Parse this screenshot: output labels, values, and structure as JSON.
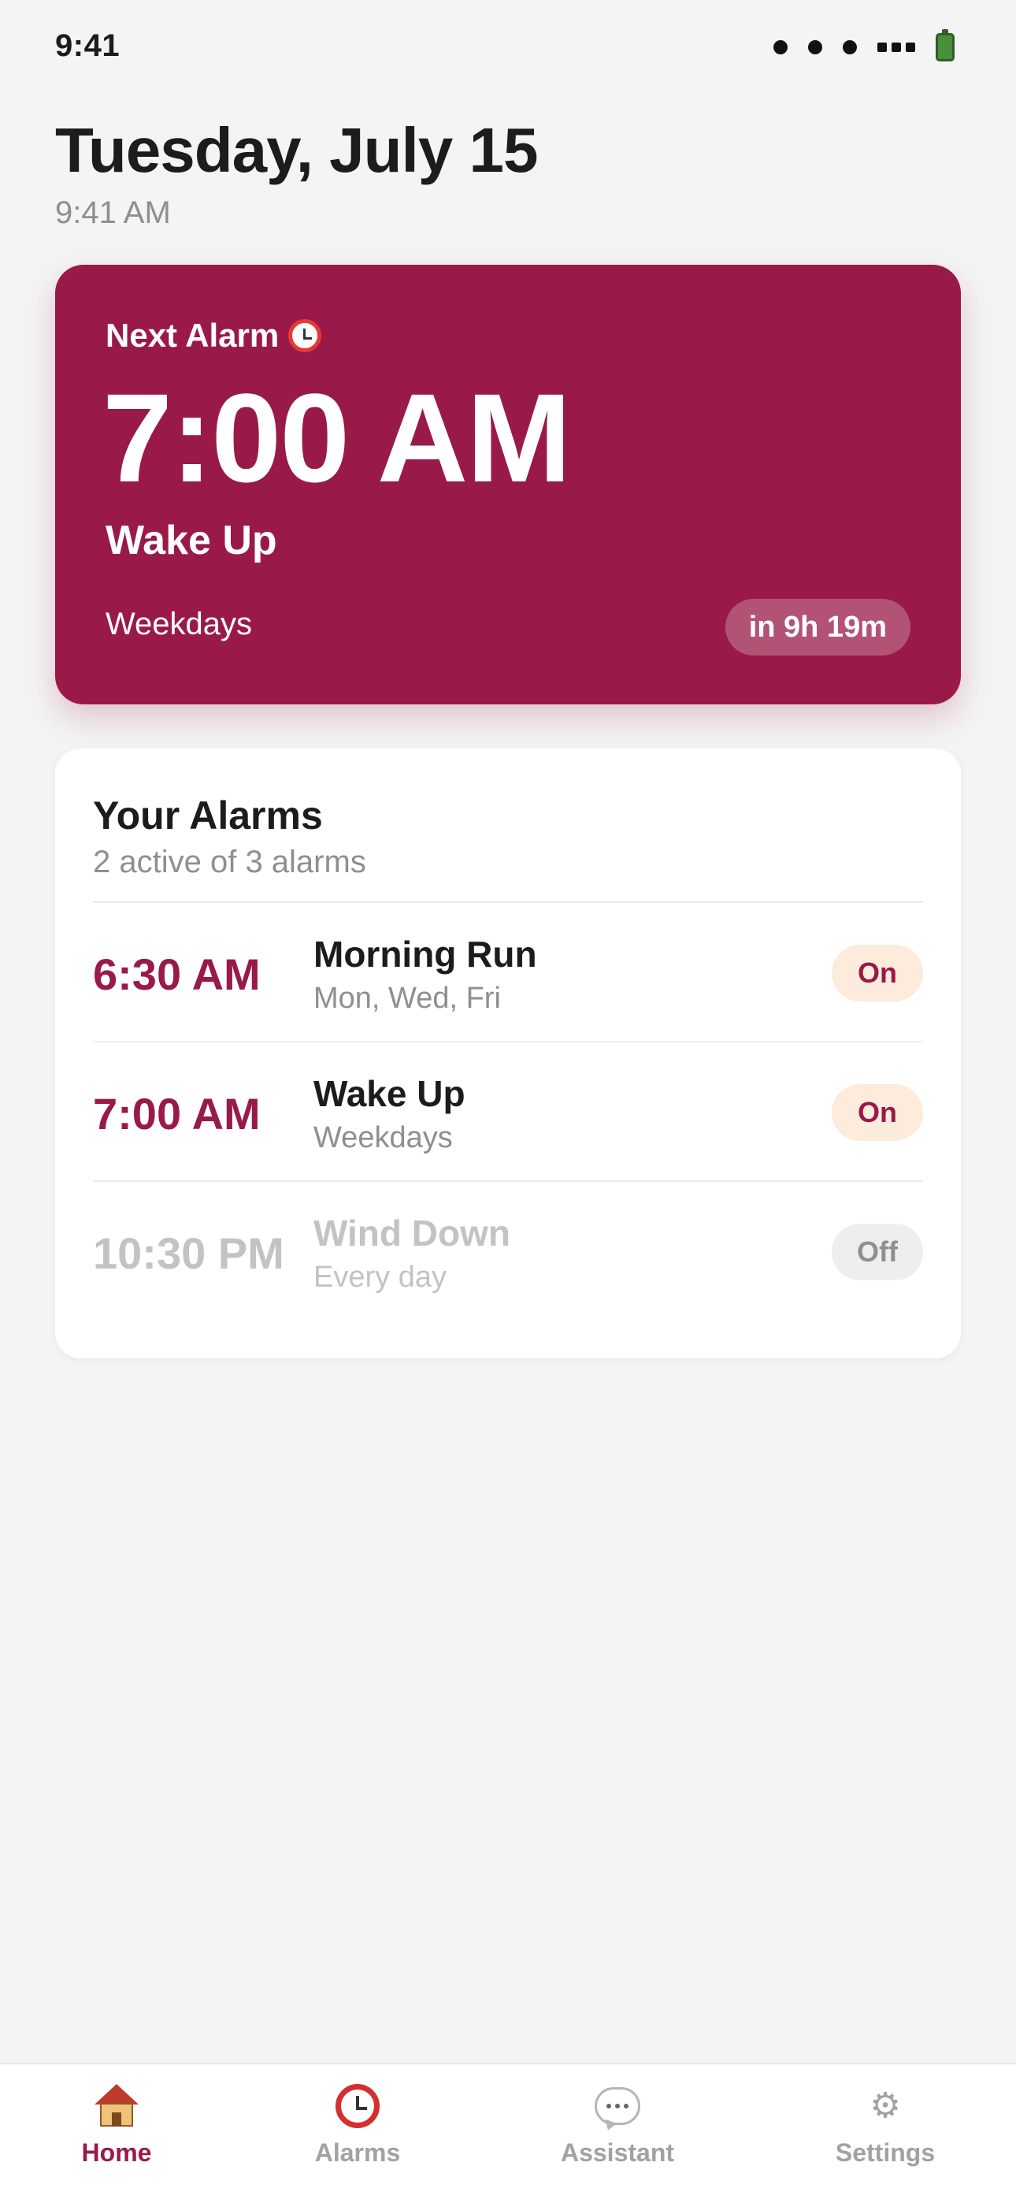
{
  "status_bar": {
    "time": "9:41",
    "signal_icon": "signal-dots-icon",
    "battery_icon": "battery-icon"
  },
  "header": {
    "date": "Tuesday, July 15",
    "time": "9:41 AM"
  },
  "next_alarm": {
    "label": "Next Alarm",
    "icon": "alarm-clock-icon",
    "time": "7:00 AM",
    "name": "Wake Up",
    "repeat": "Weekdays",
    "countdown": "in 9h 19m"
  },
  "alarms": {
    "title": "Your Alarms",
    "subtitle": "2 active of 3 alarms",
    "items": [
      {
        "time": "6:30 AM",
        "name": "Morning Run",
        "days": "Mon, Wed, Fri",
        "toggle_label": "On",
        "enabled": true
      },
      {
        "time": "7:00 AM",
        "name": "Wake Up",
        "days": "Weekdays",
        "toggle_label": "On",
        "enabled": true
      },
      {
        "time": "10:30 PM",
        "name": "Wind Down",
        "days": "Every day",
        "toggle_label": "Off",
        "enabled": false
      }
    ]
  },
  "tab_bar": {
    "items": [
      {
        "label": "Home",
        "icon": "house-icon",
        "active": true
      },
      {
        "label": "Alarms",
        "icon": "alarm-clock-icon",
        "active": false
      },
      {
        "label": "Assistant",
        "icon": "speech-bubble-icon",
        "active": false
      },
      {
        "label": "Settings",
        "icon": "gear-icon",
        "active": false
      }
    ]
  },
  "colors": {
    "accent": "#991a49",
    "toggle_on_bg": "#fdebdc",
    "toggle_off_bg": "#eeeeee",
    "background": "#f4f4f4"
  }
}
